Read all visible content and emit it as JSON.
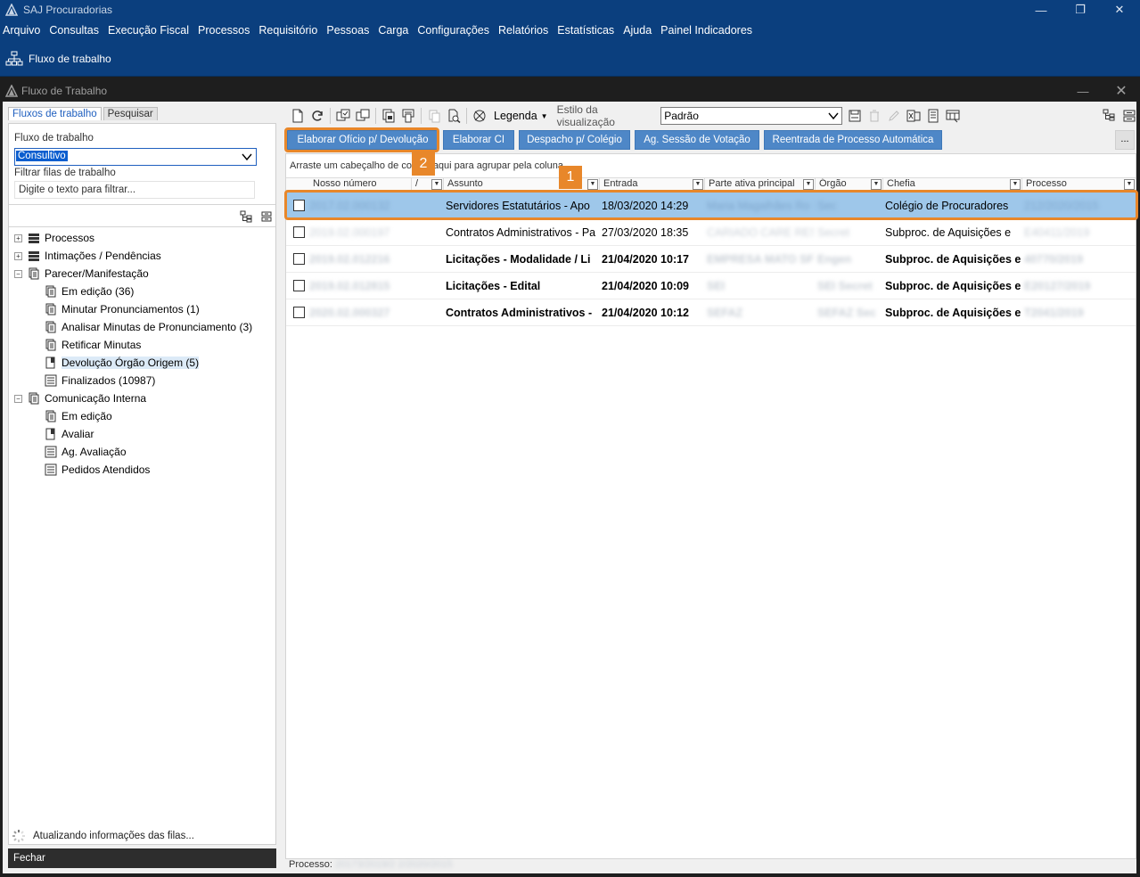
{
  "app": {
    "title": "SAJ Procuradorias",
    "menu": [
      "Arquivo",
      "Consultas",
      "Execução Fiscal",
      "Processos",
      "Requisitório",
      "Pessoas",
      "Carga",
      "Configurações",
      "Relatórios",
      "Estatísticas",
      "Ajuda",
      "Painel Indicadores"
    ],
    "ribbon_label": "Fluxo de trabalho"
  },
  "window": {
    "title": "Fluxo de Trabalho"
  },
  "left": {
    "tabs": [
      "Fluxos de trabalho",
      "Pesquisar"
    ],
    "flow_label": "Fluxo de trabalho",
    "flow_value": "Consultivo",
    "filter_label": "Filtrar filas de trabalho",
    "filter_placeholder": "Digite o texto para filtrar...",
    "tree": [
      {
        "label": "Processos",
        "level": 0,
        "icon": "stack-icon"
      },
      {
        "label": "Intimações / Pendências",
        "level": 0,
        "icon": "stack-icon"
      },
      {
        "label": "Parecer/Manifestação",
        "level": 0,
        "icon": "document-copy-icon"
      },
      {
        "label": "Em edição (36)",
        "level": 1,
        "icon": "document-copy-icon"
      },
      {
        "label": "Minutar Pronunciamentos (1)",
        "level": 1,
        "icon": "document-copy-icon"
      },
      {
        "label": "Analisar Minutas de Pronunciamento (3)",
        "level": 1,
        "icon": "document-copy-icon"
      },
      {
        "label": "Retificar Minutas",
        "level": 1,
        "icon": "document-copy-icon"
      },
      {
        "label": "Devolução Órgão Origem (5)",
        "level": 1,
        "icon": "document-return-icon",
        "selected": true
      },
      {
        "label": "Finalizados (10987)",
        "level": 1,
        "icon": "archive-icon"
      },
      {
        "label": "Comunicação Interna",
        "level": 0,
        "icon": "document-copy-icon"
      },
      {
        "label": "Em edição",
        "level": 1,
        "icon": "document-copy-icon"
      },
      {
        "label": "Avaliar",
        "level": 1,
        "icon": "document-return-icon"
      },
      {
        "label": "Ag. Avaliação",
        "level": 1,
        "icon": "archive-icon"
      },
      {
        "label": "Pedidos Atendidos",
        "level": 1,
        "icon": "archive-icon"
      }
    ],
    "status_msg": "Atualizando informações das filas...",
    "close_label": "Fechar"
  },
  "toolbar": {
    "legend_label": "Legenda",
    "style_label": "Estilo da visualização",
    "style_value": "Padrão"
  },
  "actions": [
    "Elaborar Ofício p/ Devolução",
    "Elaborar CI",
    "Despacho p/ Colégio",
    "Ag. Sessão de Votação",
    "Reentrada de Processo Automática"
  ],
  "more_label": "...",
  "grid": {
    "group_hint": "Arraste um cabeçalho de coluna aqui para agrupar pela coluna",
    "columns": [
      "Nosso número",
      "/",
      "Assunto",
      "Entrada",
      "Parte ativa principal",
      "Órgão",
      "Chefia",
      "Processo"
    ],
    "rows": [
      {
        "numero": "2017.02.000132",
        "assunto": "Servidores Estatutários - Apo",
        "entrada": "18/03/2020 14:29",
        "parte": "Maria Magalhães Ro DOSES",
        "orgao": "Sec",
        "chefia": "Colégio de Procuradores",
        "processo": "212/2020/2015",
        "bold": false,
        "selected": true
      },
      {
        "numero": "2019.02.000197",
        "assunto": "Contratos Administrativos - Pa",
        "entrada": "27/03/2020 18:35",
        "parte": "CARIADO CARE RESCUEU",
        "orgao": "Secret",
        "chefia": "Subproc. de Aquisições e",
        "processo": "E40411/2019",
        "bold": false,
        "selected": false
      },
      {
        "numero": "2019.02.012216",
        "assunto": "Licitações - Modalidade / Li",
        "entrada": "21/04/2020 10:17",
        "parte": "EMPRESA MATO SFIRTI",
        "orgao": "Engen",
        "chefia": "Subproc. de Aquisições e",
        "processo": "40770/2019",
        "bold": true,
        "selected": false
      },
      {
        "numero": "2019.02.012815",
        "assunto": "Licitações - Edital",
        "entrada": "21/04/2020 10:09",
        "parte": "SEI",
        "orgao": "SEI Secret",
        "chefia": "Subproc. de Aquisições e",
        "processo": "E20127/2019",
        "bold": true,
        "selected": false
      },
      {
        "numero": "2020.02.000327",
        "assunto": "Contratos Administrativos -",
        "entrada": "21/04/2020 10:12",
        "parte": "SEFAZ",
        "orgao": "SEFAZ Sec",
        "chefia": "Subproc. de Aquisições e",
        "processo": "T2041/2019",
        "bold": true,
        "selected": false
      }
    ]
  },
  "status_bar": {
    "label": "Processo:",
    "value": "20173/2019/2 2/2020/2015"
  },
  "callouts": [
    "1",
    "2"
  ],
  "colors": {
    "title_bar": "#0b3f7e",
    "action_button": "#4e87c7",
    "selected_row": "#9ec7ea",
    "callout": "#e8872a"
  }
}
